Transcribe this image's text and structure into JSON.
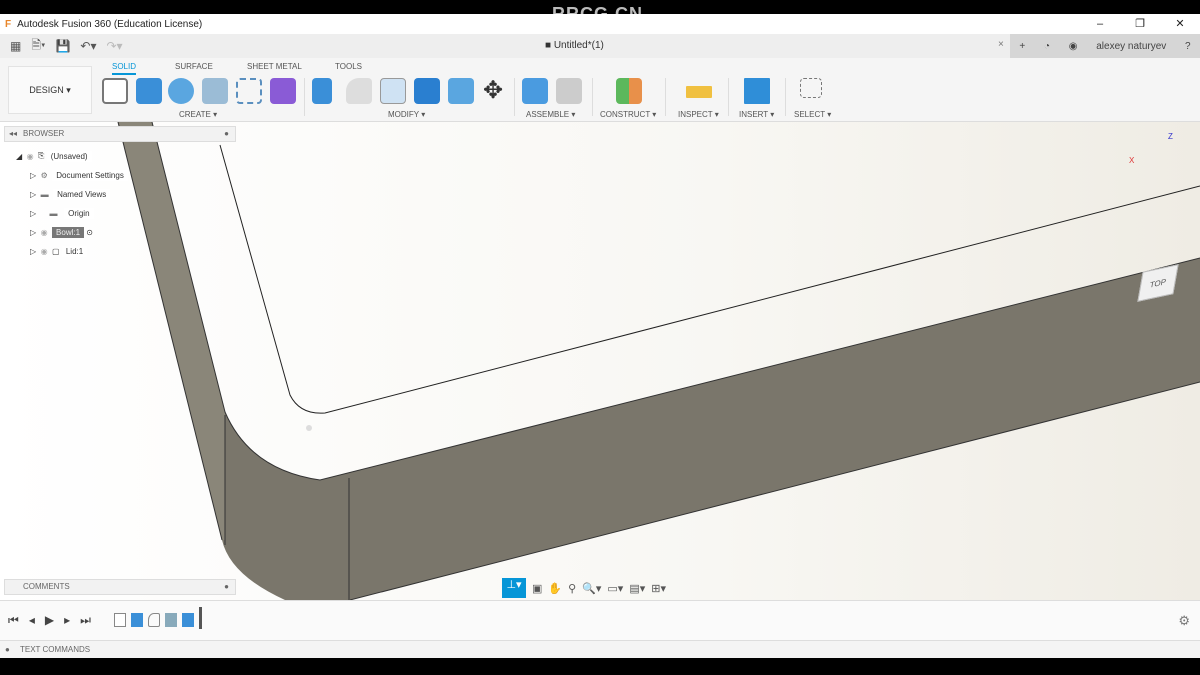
{
  "window": {
    "title": "Autodesk Fusion 360 (Education License)",
    "minimize": "–",
    "maximize": "❐",
    "close": "✕"
  },
  "watermark": "RRCG.CN",
  "doc": {
    "tab": "Untitled*(1)",
    "close": "×",
    "user": "alexey naturyev"
  },
  "workspace": "DESIGN ▾",
  "tabs": [
    "SOLID",
    "SURFACE",
    "SHEET METAL",
    "TOOLS"
  ],
  "groups": [
    "CREATE ▾",
    "MODIFY ▾",
    "ASSEMBLE ▾",
    "CONSTRUCT ▾",
    "INSPECT ▾",
    "INSERT ▾",
    "SELECT ▾"
  ],
  "browser": {
    "title": "BROWSER",
    "items": [
      "(Unsaved)",
      "Document Settings",
      "Named Views",
      "Origin",
      "Bowl:1",
      "Lid:1"
    ]
  },
  "viewcube": {
    "face": "TOP",
    "x": "X",
    "z": "Z"
  },
  "comments": "COMMENTS",
  "text_commands": "TEXT COMMANDS"
}
